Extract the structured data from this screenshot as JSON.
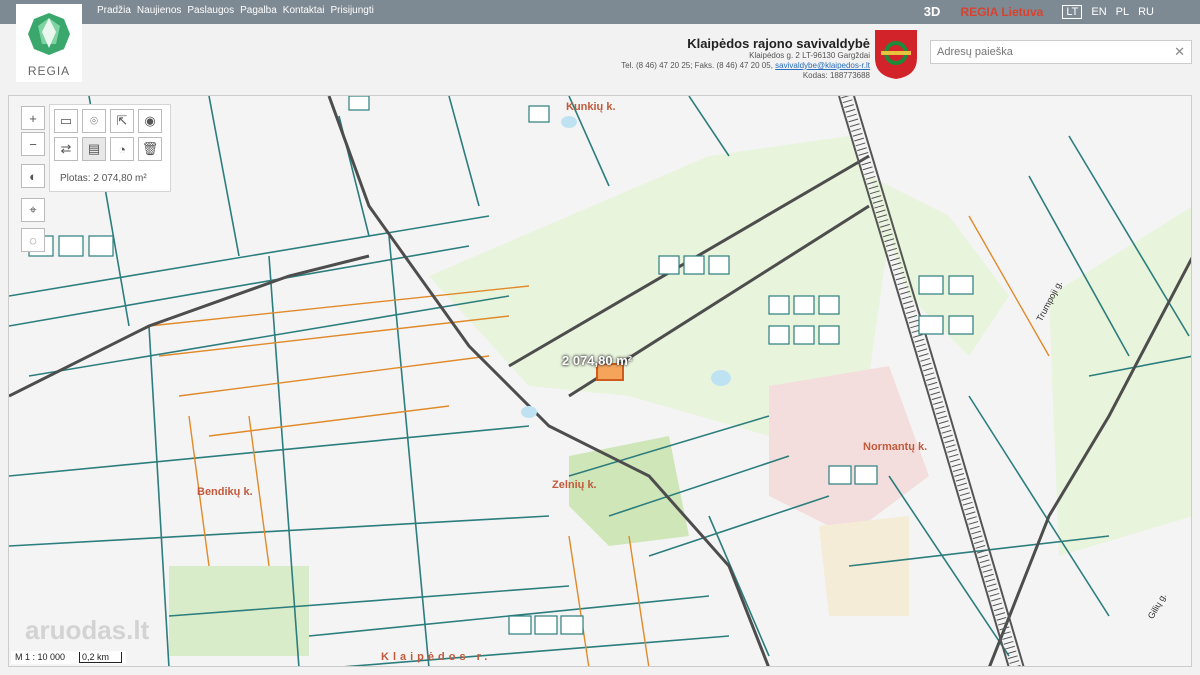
{
  "nav": {
    "items": [
      "Pradžia",
      "Naujienos",
      "Paslaugos",
      "Pagalba",
      "Kontaktai",
      "Prisijungti"
    ],
    "right": {
      "three_d": "3D",
      "regia": "REGIA Lietuva",
      "langs": [
        "LT",
        "EN",
        "PL",
        "RU"
      ]
    }
  },
  "logo": {
    "text": "REGIA"
  },
  "municipality": {
    "name": "Klaipėdos rajono savivaldybė",
    "address": "Klaipėdos g. 2 LT-96130 Gargždai",
    "phone_prefix": "Tel. (8 46) 47 20 25; Faks. (8 46) 47 20 05, ",
    "email": "savivaldybe@klaipedos-r.lt",
    "code": "Kodas: 188773688"
  },
  "search": {
    "placeholder": "Adresų paieška",
    "clear": "✕"
  },
  "map": {
    "area_text": "Plotas: 2 074,80 m²",
    "area_label": "2 074,80 m²",
    "place_labels": [
      "Kunkių k.",
      "Bendikų k.",
      "Zelnių k.",
      "Normantų k.",
      "Klaipėdos r."
    ],
    "scale_ratio": "M 1 : 10 000",
    "scale_bar": "0,2 km",
    "watermark": "aruodas.lt",
    "street_labels": [
      "Trumpoji g.",
      "Gilių g."
    ]
  },
  "colors": {
    "parcel": "#2c7d7d",
    "proposed": "#e08a2a",
    "road": "#4d4d4d",
    "rail": "#555555",
    "green": "#d9ecc9",
    "accent": "#d9412e"
  }
}
